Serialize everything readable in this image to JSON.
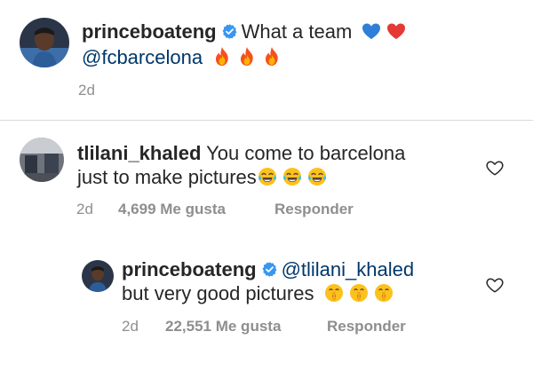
{
  "caption": {
    "username": "princeboateng",
    "text": "What a team",
    "mention": "@fcbarcelona",
    "time": "2d",
    "text_emojis": [
      "blue-heart",
      "red-heart"
    ],
    "mention_emojis": [
      "fire",
      "fire",
      "fire"
    ]
  },
  "comments": [
    {
      "username": "tlilani_khaled",
      "text_line1": "You come to barcelona",
      "text_line2": "just to make pictures",
      "emojis": [
        "tears-of-joy",
        "tears-of-joy",
        "tears-of-joy"
      ],
      "time": "2d",
      "likes": "4,699 Me gusta",
      "reply_label": "Responder"
    }
  ],
  "replies": [
    {
      "username": "princeboateng",
      "mention": "@tlilani_khaled",
      "text": "but very good pictures",
      "emojis": [
        "shushing-face",
        "shushing-face",
        "shushing-face"
      ],
      "time": "2d",
      "likes": "22,551 Me gusta",
      "reply_label": "Responder"
    }
  ],
  "colors": {
    "text": "#262626",
    "secondary": "#8e8e8e",
    "link": "#00376b",
    "verified": "#3897f0",
    "divider": "#dbdbdb"
  }
}
